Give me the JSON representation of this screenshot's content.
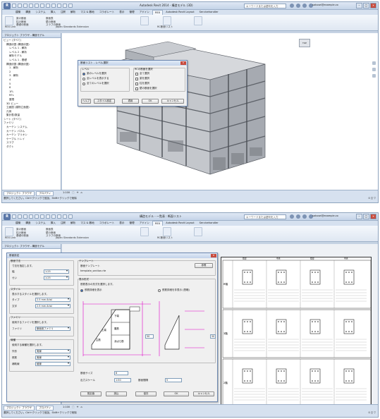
{
  "window": {
    "title_top": "Autodesk Revit 2014 - 構造モデル (3D)",
    "title_bottom": "構造モデル - 一覧表 : 断面リスト",
    "search_placeholder": "キーワードまたは語句を入力",
    "user": "sakusei@example.co",
    "app_button": "R"
  },
  "ribbon": {
    "tabs": [
      "建築",
      "構造",
      "システム",
      "挿入",
      "注釈",
      "解析",
      "マス & 敷地",
      "コラボレート",
      "表示",
      "管理",
      "アドイン",
      "REX",
      "Autodesk Revit Layout",
      "Servicehandler"
    ],
    "active_tab": "REX",
    "panels": {
      "panel1": "REX Link",
      "panel2": "Japan Standards Extension",
      "panel3": "RC断面リスト",
      "btn_a": "断面リスト",
      "btn_b": "断面リスト"
    },
    "group_items": [
      "梁の断面",
      "柱の断面",
      "基礎の断面",
      "断面表",
      "壁の断面",
      "スラブの断面"
    ]
  },
  "browser": {
    "title_top": "プロジェクト ブラウザ - 構造モデル",
    "title_bottom": "プロジェクト ブラウザ - 構造モデル",
    "items": [
      "ビュー (すべて)",
      "構造伏図 (構造伏図)",
      "レベル 1 - 解析",
      "レベル 2 - 解析",
      "解析モデル",
      "レベル 1 - 基礎",
      "構造伏図 (構造伏図)",
      "1 - 解析",
      "2",
      "3 - 解析",
      "4",
      "5",
      "6",
      "1FL",
      "RFL",
      "屋根",
      "3D ビュー",
      "立面図 (建物立面図)",
      "凡例",
      "集計表/数量",
      "シート (すべて)",
      "ファミリ",
      "カーテン システム",
      "カーテン パネル",
      "カーテン マリオン",
      "ケーブル トレイ",
      "スラブ",
      "ダクト"
    ]
  },
  "dialog_top": {
    "title": "断面リスト - レベル選択",
    "group1_title": "レベル",
    "opt1": "梁のレベルを選択",
    "opt2": "全レベルを表示する",
    "opt3": "全てのレベルを選択",
    "group2_title": "RCの断面を選択",
    "opt4": "全て選択",
    "opt5": "梁を選択",
    "opt6": "柱を選択",
    "opt7": "壁の断面を選択",
    "btn_help": "ヘルプ",
    "btn_settings": "スタイル設定",
    "btn_apply": "適用",
    "btn_ok": "OK",
    "btn_cancel": "キャンセル"
  },
  "dialog_bottom": {
    "title": "断面設定",
    "sec_size": "断面寸法",
    "size_note": "寸法を指定します。",
    "w_label": "幅",
    "w_value": "1:25",
    "d_label": "せい",
    "d_value": "1:25",
    "sec_style": "スタイル",
    "style_note": "表示するスタイルを選択します。",
    "type_label": "タイプ",
    "type_value": "2.5 mm Arial",
    "font_label": "文字",
    "font_value": "2.5 mm Arial",
    "sec_family": "ファミリ",
    "family_note": "使用するファミリを選択します。",
    "family_label": "ファミリ",
    "family_value": "断面用ファミリ",
    "sec_line": "線種",
    "line_note": "使用する線種を選択します。",
    "line1": "外形",
    "line1_value": "実線",
    "line2": "鉄筋",
    "line2_value": "実線",
    "line3": "補助線",
    "line3_value": "破線",
    "sec_template": "テンプレート",
    "template_note": "断面テンプレート",
    "template_path": "template_section.rte",
    "btn_browse": "参照",
    "sec_detail": "表示形式",
    "detail_note": "鉄筋表示の形式を選択します。",
    "opt_show_rebar": "鉄筋詳細を表示",
    "opt_hide_rebar": "鉄筋詳細を非表示 (簡略)",
    "diag_labels": [
      "上端",
      "下端",
      "腹筋",
      "あばら筋",
      "主筋"
    ],
    "dim_a": "50",
    "dim_b": "50",
    "field_size_label": "断面サイズ",
    "field_size_value": "8",
    "field_scale_label": "出力スケール",
    "field_scale_value": "1:50",
    "field_spacing_label": "断面間隔",
    "field_spacing_value": "5",
    "btn_default": "既定値",
    "btn_load": "読込",
    "btn_save": "保存",
    "btn_ok": "OK",
    "btn_cancel": "キャンセル"
  },
  "sheet": {
    "row_groups": [
      "R階",
      "3階",
      "2階"
    ],
    "cols": [
      "G1",
      "G2"
    ],
    "sub_cols": [
      "端部",
      "中央",
      "端部",
      "中央"
    ]
  },
  "status_top": {
    "tabs": [
      "プロジェクト ブラウザ",
      "プロパティ"
    ],
    "viewbar": [
      "1:100",
      "⬚",
      "☀",
      "⌂"
    ],
    "text": "選択してください。Ctrl+クリックで追加、Shift+クリックで削除",
    "right": "0  ◫ ▽"
  },
  "status_bottom": {
    "tabs": [
      "プロジェクト ブラウザ",
      "プロパティ"
    ],
    "viewbar": [
      "1:100",
      "⬚",
      "☀",
      "⌂"
    ],
    "text": "選択してください。Ctrl+クリックで追加、Shift+クリックで削除",
    "right": "0  ◫ ▽"
  },
  "colors": {
    "ribbon": "#dfe7f2",
    "dialog": "#f0f0f0",
    "accent": "#1f5fbf",
    "magenta_marks": "#e000c8"
  }
}
